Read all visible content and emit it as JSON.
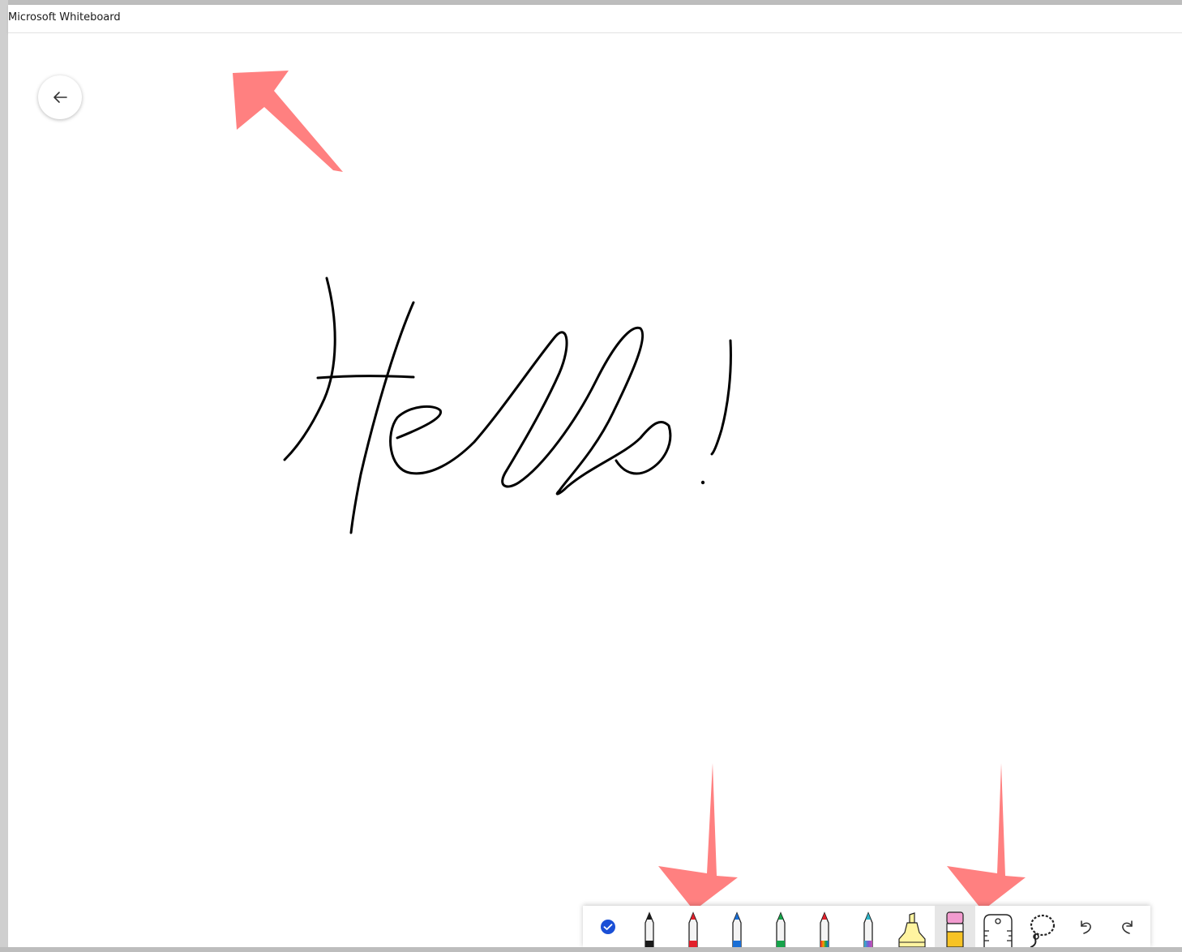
{
  "window": {
    "title": "Microsoft Whiteboard"
  },
  "canvas": {
    "back_icon": "arrow-left-icon",
    "ink_color": "#000000"
  },
  "annotations": {
    "arrow_color": "#ff8080"
  },
  "toolbar": {
    "tools": [
      {
        "name": "select",
        "icon": "checkmark-circle-icon",
        "color": "#1a4fd6",
        "selected": false
      },
      {
        "name": "pen-black",
        "icon": "pen-icon",
        "color": "#1a1a1a",
        "selected": false
      },
      {
        "name": "pen-red",
        "icon": "pen-icon",
        "color": "#e2202b",
        "selected": false
      },
      {
        "name": "pen-blue",
        "icon": "pen-icon",
        "color": "#1a6fd6",
        "selected": false
      },
      {
        "name": "pen-green",
        "icon": "pen-icon",
        "color": "#16a34a",
        "selected": false
      },
      {
        "name": "pen-rainbow",
        "icon": "pen-icon",
        "color": "#ff8a00",
        "selected": false
      },
      {
        "name": "pen-galaxy",
        "icon": "pen-icon",
        "color": "#7a5bd6",
        "selected": false
      },
      {
        "name": "highlighter",
        "icon": "highlighter-icon",
        "color": "#fff4a0",
        "selected": false
      },
      {
        "name": "eraser",
        "icon": "eraser-icon",
        "color": "#f7c325",
        "selected": true
      },
      {
        "name": "ruler",
        "icon": "ruler-icon",
        "color": "#333333",
        "selected": false
      },
      {
        "name": "lasso",
        "icon": "lasso-icon",
        "color": "#333333",
        "selected": false
      },
      {
        "name": "undo",
        "icon": "undo-icon",
        "color": "#333333",
        "selected": false
      },
      {
        "name": "redo",
        "icon": "redo-icon",
        "color": "#333333",
        "selected": false
      }
    ]
  }
}
